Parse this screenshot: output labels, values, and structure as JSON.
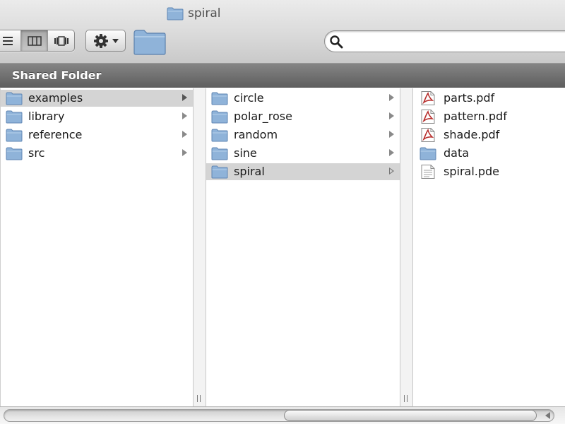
{
  "window": {
    "title": "spiral"
  },
  "toolbar": {
    "view_buttons": [
      {
        "name": "list-view-icon",
        "selected": false
      },
      {
        "name": "column-view-icon",
        "selected": true
      },
      {
        "name": "coverflow-view-icon",
        "selected": false
      }
    ],
    "action_icon": "gear-icon",
    "new_folder_icon": "folder-icon"
  },
  "search": {
    "value": "",
    "placeholder": ""
  },
  "header": {
    "title": "Shared Folder"
  },
  "columns": [
    {
      "items": [
        {
          "label": "examples",
          "icon": "folder-icon",
          "selected": true
        },
        {
          "label": "library",
          "icon": "folder-icon",
          "selected": false
        },
        {
          "label": "reference",
          "icon": "folder-icon",
          "selected": false
        },
        {
          "label": "src",
          "icon": "folder-icon",
          "selected": false
        }
      ]
    },
    {
      "items": [
        {
          "label": "circle",
          "icon": "folder-icon",
          "selected": false
        },
        {
          "label": "polar_rose",
          "icon": "folder-icon",
          "selected": false
        },
        {
          "label": "random",
          "icon": "folder-icon",
          "selected": false
        },
        {
          "label": "sine",
          "icon": "folder-icon",
          "selected": false
        },
        {
          "label": "spiral",
          "icon": "folder-icon",
          "selected": true
        }
      ]
    },
    {
      "items": [
        {
          "label": "parts.pdf",
          "icon": "pdf-icon"
        },
        {
          "label": "pattern.pdf",
          "icon": "pdf-icon"
        },
        {
          "label": "shade.pdf",
          "icon": "pdf-icon"
        },
        {
          "label": "data",
          "icon": "folder-icon"
        },
        {
          "label": "spiral.pde",
          "icon": "document-icon"
        }
      ]
    }
  ],
  "colors": {
    "folder": "#8fb3d9",
    "selection": "#d4d4d4",
    "header": "#6e6e6e",
    "pdf": "#b8312f"
  }
}
